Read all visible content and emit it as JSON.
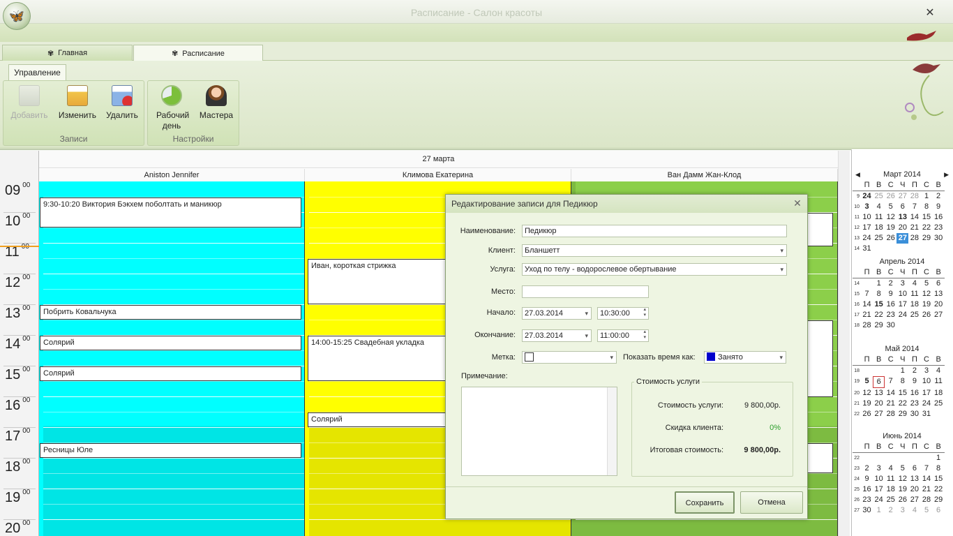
{
  "window": {
    "title": "Расписание - Салон красоты",
    "close": "✕",
    "logo": "🦋"
  },
  "tabs": [
    {
      "label": "Главная",
      "icon": "butterfly-icon"
    },
    {
      "label": "Расписание",
      "icon": "butterfly-icon"
    }
  ],
  "ribbon": {
    "tab": "Управление",
    "groups": [
      {
        "label": "Записи",
        "buttons": [
          {
            "label": "Добавить",
            "icon": "calendar-add-icon",
            "disabled": true
          },
          {
            "label": "Изменить",
            "icon": "calendar-edit-icon"
          },
          {
            "label": "Удалить",
            "icon": "calendar-delete-icon"
          }
        ]
      },
      {
        "label": "Настройки",
        "buttons": [
          {
            "label": "Рабочий день",
            "icon": "pie-chart-icon"
          },
          {
            "label": "Мастера",
            "icon": "person-icon"
          }
        ]
      }
    ]
  },
  "schedule": {
    "date": "27 марта",
    "columns": [
      {
        "name": "Aniston Jennifer",
        "color": "#00ffff",
        "color2": "#00e5e5"
      },
      {
        "name": "Климова Екатерина",
        "color": "#ffff00",
        "color2": "#e5e500"
      },
      {
        "name": "Ван Дамм Жан-Клод",
        "color": "#8ccf4a",
        "color2": "#7dbb41"
      }
    ],
    "hours": [
      {
        "h": "09",
        "m": "00"
      },
      {
        "h": "10",
        "m": "00"
      },
      {
        "h": "11",
        "m": "00"
      },
      {
        "h": "12",
        "m": "00"
      },
      {
        "h": "13",
        "m": "00"
      },
      {
        "h": "14",
        "m": "00"
      },
      {
        "h": "15",
        "m": "00"
      },
      {
        "h": "16",
        "m": "00"
      },
      {
        "h": "17",
        "m": "00"
      },
      {
        "h": "18",
        "m": "00"
      },
      {
        "h": "19",
        "m": "00"
      },
      {
        "h": "20",
        "m": "00"
      }
    ],
    "events": [
      {
        "col": 0,
        "text": "9:30-10:20 Виктория Бэкхем поболтать и маникюр"
      },
      {
        "col": 0,
        "text": "Побрить Ковальчука"
      },
      {
        "col": 0,
        "text": "Солярий"
      },
      {
        "col": 0,
        "text": "Солярий"
      },
      {
        "col": 0,
        "text": "Ресницы Юле"
      },
      {
        "col": 1,
        "text": "Иван, короткая стрижка"
      },
      {
        "col": 1,
        "text": "14:00-15:25 Свадебная укладка"
      },
      {
        "col": 1,
        "text": "Солярий"
      }
    ]
  },
  "minical": [
    {
      "title": "Март 2014",
      "prev": "◀",
      "next": "▶",
      "days": [
        "П",
        "В",
        "С",
        "Ч",
        "П",
        "С",
        "В"
      ],
      "weeks": [
        {
          "wk": "9",
          "d": [
            "24",
            "25",
            "26",
            "27",
            "28",
            "1",
            "2"
          ]
        },
        {
          "wk": "10",
          "d": [
            "3",
            "4",
            "5",
            "6",
            "7",
            "8",
            "9"
          ]
        },
        {
          "wk": "11",
          "d": [
            "10",
            "11",
            "12",
            "13",
            "14",
            "15",
            "16"
          ]
        },
        {
          "wk": "12",
          "d": [
            "17",
            "18",
            "19",
            "20",
            "21",
            "22",
            "23"
          ]
        },
        {
          "wk": "13",
          "d": [
            "24",
            "25",
            "26",
            "27",
            "28",
            "29",
            "30"
          ]
        },
        {
          "wk": "14",
          "d": [
            "31",
            "",
            "",
            "",
            "",
            "",
            ""
          ]
        }
      ]
    },
    {
      "title": "Апрель 2014",
      "days": [
        "П",
        "В",
        "С",
        "Ч",
        "П",
        "С",
        "В"
      ],
      "weeks": [
        {
          "wk": "14",
          "d": [
            "",
            "1",
            "2",
            "3",
            "4",
            "5",
            "6"
          ]
        },
        {
          "wk": "15",
          "d": [
            "7",
            "8",
            "9",
            "10",
            "11",
            "12",
            "13"
          ]
        },
        {
          "wk": "16",
          "d": [
            "14",
            "15",
            "16",
            "17",
            "18",
            "19",
            "20"
          ]
        },
        {
          "wk": "17",
          "d": [
            "21",
            "22",
            "23",
            "24",
            "25",
            "26",
            "27"
          ]
        },
        {
          "wk": "18",
          "d": [
            "28",
            "29",
            "30",
            "",
            "",
            "",
            ""
          ]
        }
      ]
    },
    {
      "title": "Май 2014",
      "days": [
        "П",
        "В",
        "С",
        "Ч",
        "П",
        "С",
        "В"
      ],
      "weeks": [
        {
          "wk": "18",
          "d": [
            "",
            "",
            "",
            "1",
            "2",
            "3",
            "4"
          ]
        },
        {
          "wk": "19",
          "d": [
            "5",
            "6",
            "7",
            "8",
            "9",
            "10",
            "11"
          ]
        },
        {
          "wk": "20",
          "d": [
            "12",
            "13",
            "14",
            "15",
            "16",
            "17",
            "18"
          ]
        },
        {
          "wk": "21",
          "d": [
            "19",
            "20",
            "21",
            "22",
            "23",
            "24",
            "25"
          ]
        },
        {
          "wk": "22",
          "d": [
            "26",
            "27",
            "28",
            "29",
            "30",
            "31",
            ""
          ]
        }
      ]
    },
    {
      "title": "Июнь 2014",
      "days": [
        "П",
        "В",
        "С",
        "Ч",
        "П",
        "С",
        "В"
      ],
      "weeks": [
        {
          "wk": "22",
          "d": [
            "",
            "",
            "",
            "",
            "",
            "",
            "1"
          ]
        },
        {
          "wk": "23",
          "d": [
            "2",
            "3",
            "4",
            "5",
            "6",
            "7",
            "8"
          ]
        },
        {
          "wk": "24",
          "d": [
            "9",
            "10",
            "11",
            "12",
            "13",
            "14",
            "15"
          ]
        },
        {
          "wk": "25",
          "d": [
            "16",
            "17",
            "18",
            "19",
            "20",
            "21",
            "22"
          ]
        },
        {
          "wk": "26",
          "d": [
            "23",
            "24",
            "25",
            "26",
            "27",
            "28",
            "29"
          ]
        },
        {
          "wk": "27",
          "d": [
            "30",
            "1",
            "2",
            "3",
            "4",
            "5",
            "6"
          ]
        }
      ]
    }
  ],
  "dialog": {
    "title": "Редактирование записи для Педикюр",
    "close": "✕",
    "name_label": "Наименование:",
    "name_value": "Педикюр",
    "client_label": "Клиент:",
    "client_value": "Бланшетт",
    "service_label": "Услуга:",
    "service_value": "Уход по телу - водорослевое обертывание",
    "place_label": "Место:",
    "place_value": "",
    "start_label": "Начало:",
    "start_date": "27.03.2014",
    "start_time": "10:30:00",
    "end_label": "Окончание:",
    "end_date": "27.03.2014",
    "end_time": "11:00:00",
    "mark_label": "Метка:",
    "show_as_label": "Показать время как:",
    "show_as_value": "Занято",
    "show_as_color": "#0000cc",
    "note_label": "Примечание:",
    "cost_group": "Стоимость услуги",
    "cost_label": "Стоимость услуги:",
    "cost_value": "9 800,00р.",
    "discount_label": "Скидка клиента:",
    "discount_value": "0%",
    "total_label": "Итоговая стоимость:",
    "total_value": "9 800,00р.",
    "save": "Сохранить",
    "cancel": "Отмена"
  }
}
